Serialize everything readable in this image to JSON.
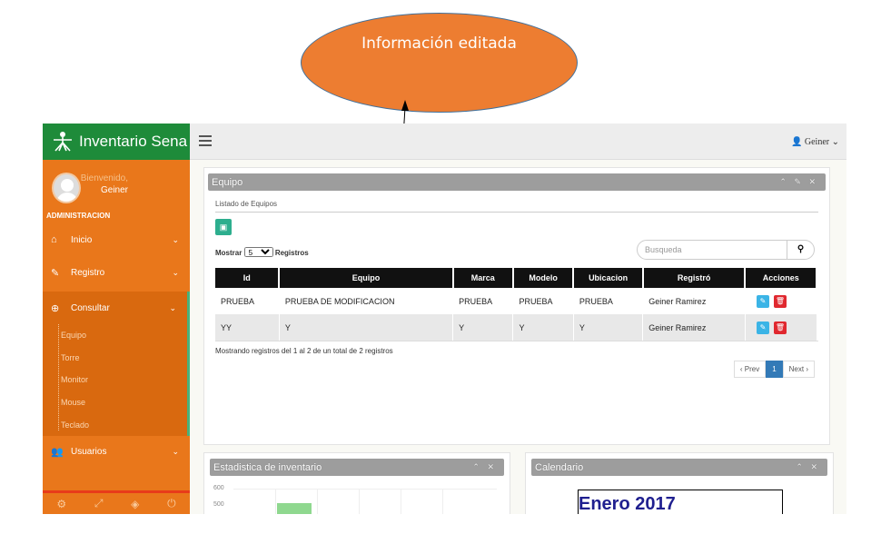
{
  "callout": {
    "text": "Información editada"
  },
  "sidebar": {
    "brand": "Inventario Sena",
    "welcome": "Bienvenido,",
    "user_name": "Geiner",
    "role": "ADMINISTRACION",
    "items": [
      {
        "label": "Inicio",
        "icon": "home-icon"
      },
      {
        "label": "Registro",
        "icon": "edit-icon"
      },
      {
        "label": "Consultar",
        "icon": "search-plus-icon"
      },
      {
        "label": "Usuarios",
        "icon": "users-icon"
      }
    ],
    "submenu": [
      "Equipo",
      "Torre",
      "Monitor",
      "Mouse",
      "Teclado"
    ],
    "footer_icons": [
      "gear-icon",
      "fullscreen-icon",
      "eye-slash-icon",
      "power-icon"
    ]
  },
  "topbar": {
    "user": "Geiner"
  },
  "equipo": {
    "title": "Equipo",
    "subtitle": "Listado de Equipos",
    "show_prefix": "Mostrar",
    "show_value": "5",
    "show_suffix": "Registros",
    "search_placeholder": "Busqueda",
    "columns": [
      "Id",
      "Equipo",
      "Marca",
      "Modelo",
      "Ubicacion",
      "Registró",
      "Acciones"
    ],
    "rows": [
      [
        "PRUEBA",
        "PRUEBA DE MODIFICACION",
        "PRUEBA",
        "PRUEBA",
        "PRUEBA",
        "Geiner Ramirez"
      ],
      [
        "YY",
        "Y",
        "Y",
        "Y",
        "Y",
        "Geiner Ramirez"
      ]
    ],
    "info": "Mostrando registros del 1 al 2 de un total de 2 registros",
    "pager": {
      "prev": "‹ Prev",
      "current": "1",
      "next": "Next ›"
    }
  },
  "estadistica": {
    "title": "Estadistica de inventario",
    "axis_ticks": [
      "600",
      "500"
    ]
  },
  "calendario": {
    "title": "Calendario",
    "month": "Enero 2017"
  },
  "colors": {
    "sidebar": "#e9771b",
    "brand_bar": "#1e8b3a",
    "callout": "#ed7d31",
    "edit": "#3bb4e6",
    "delete": "#e0282f"
  }
}
